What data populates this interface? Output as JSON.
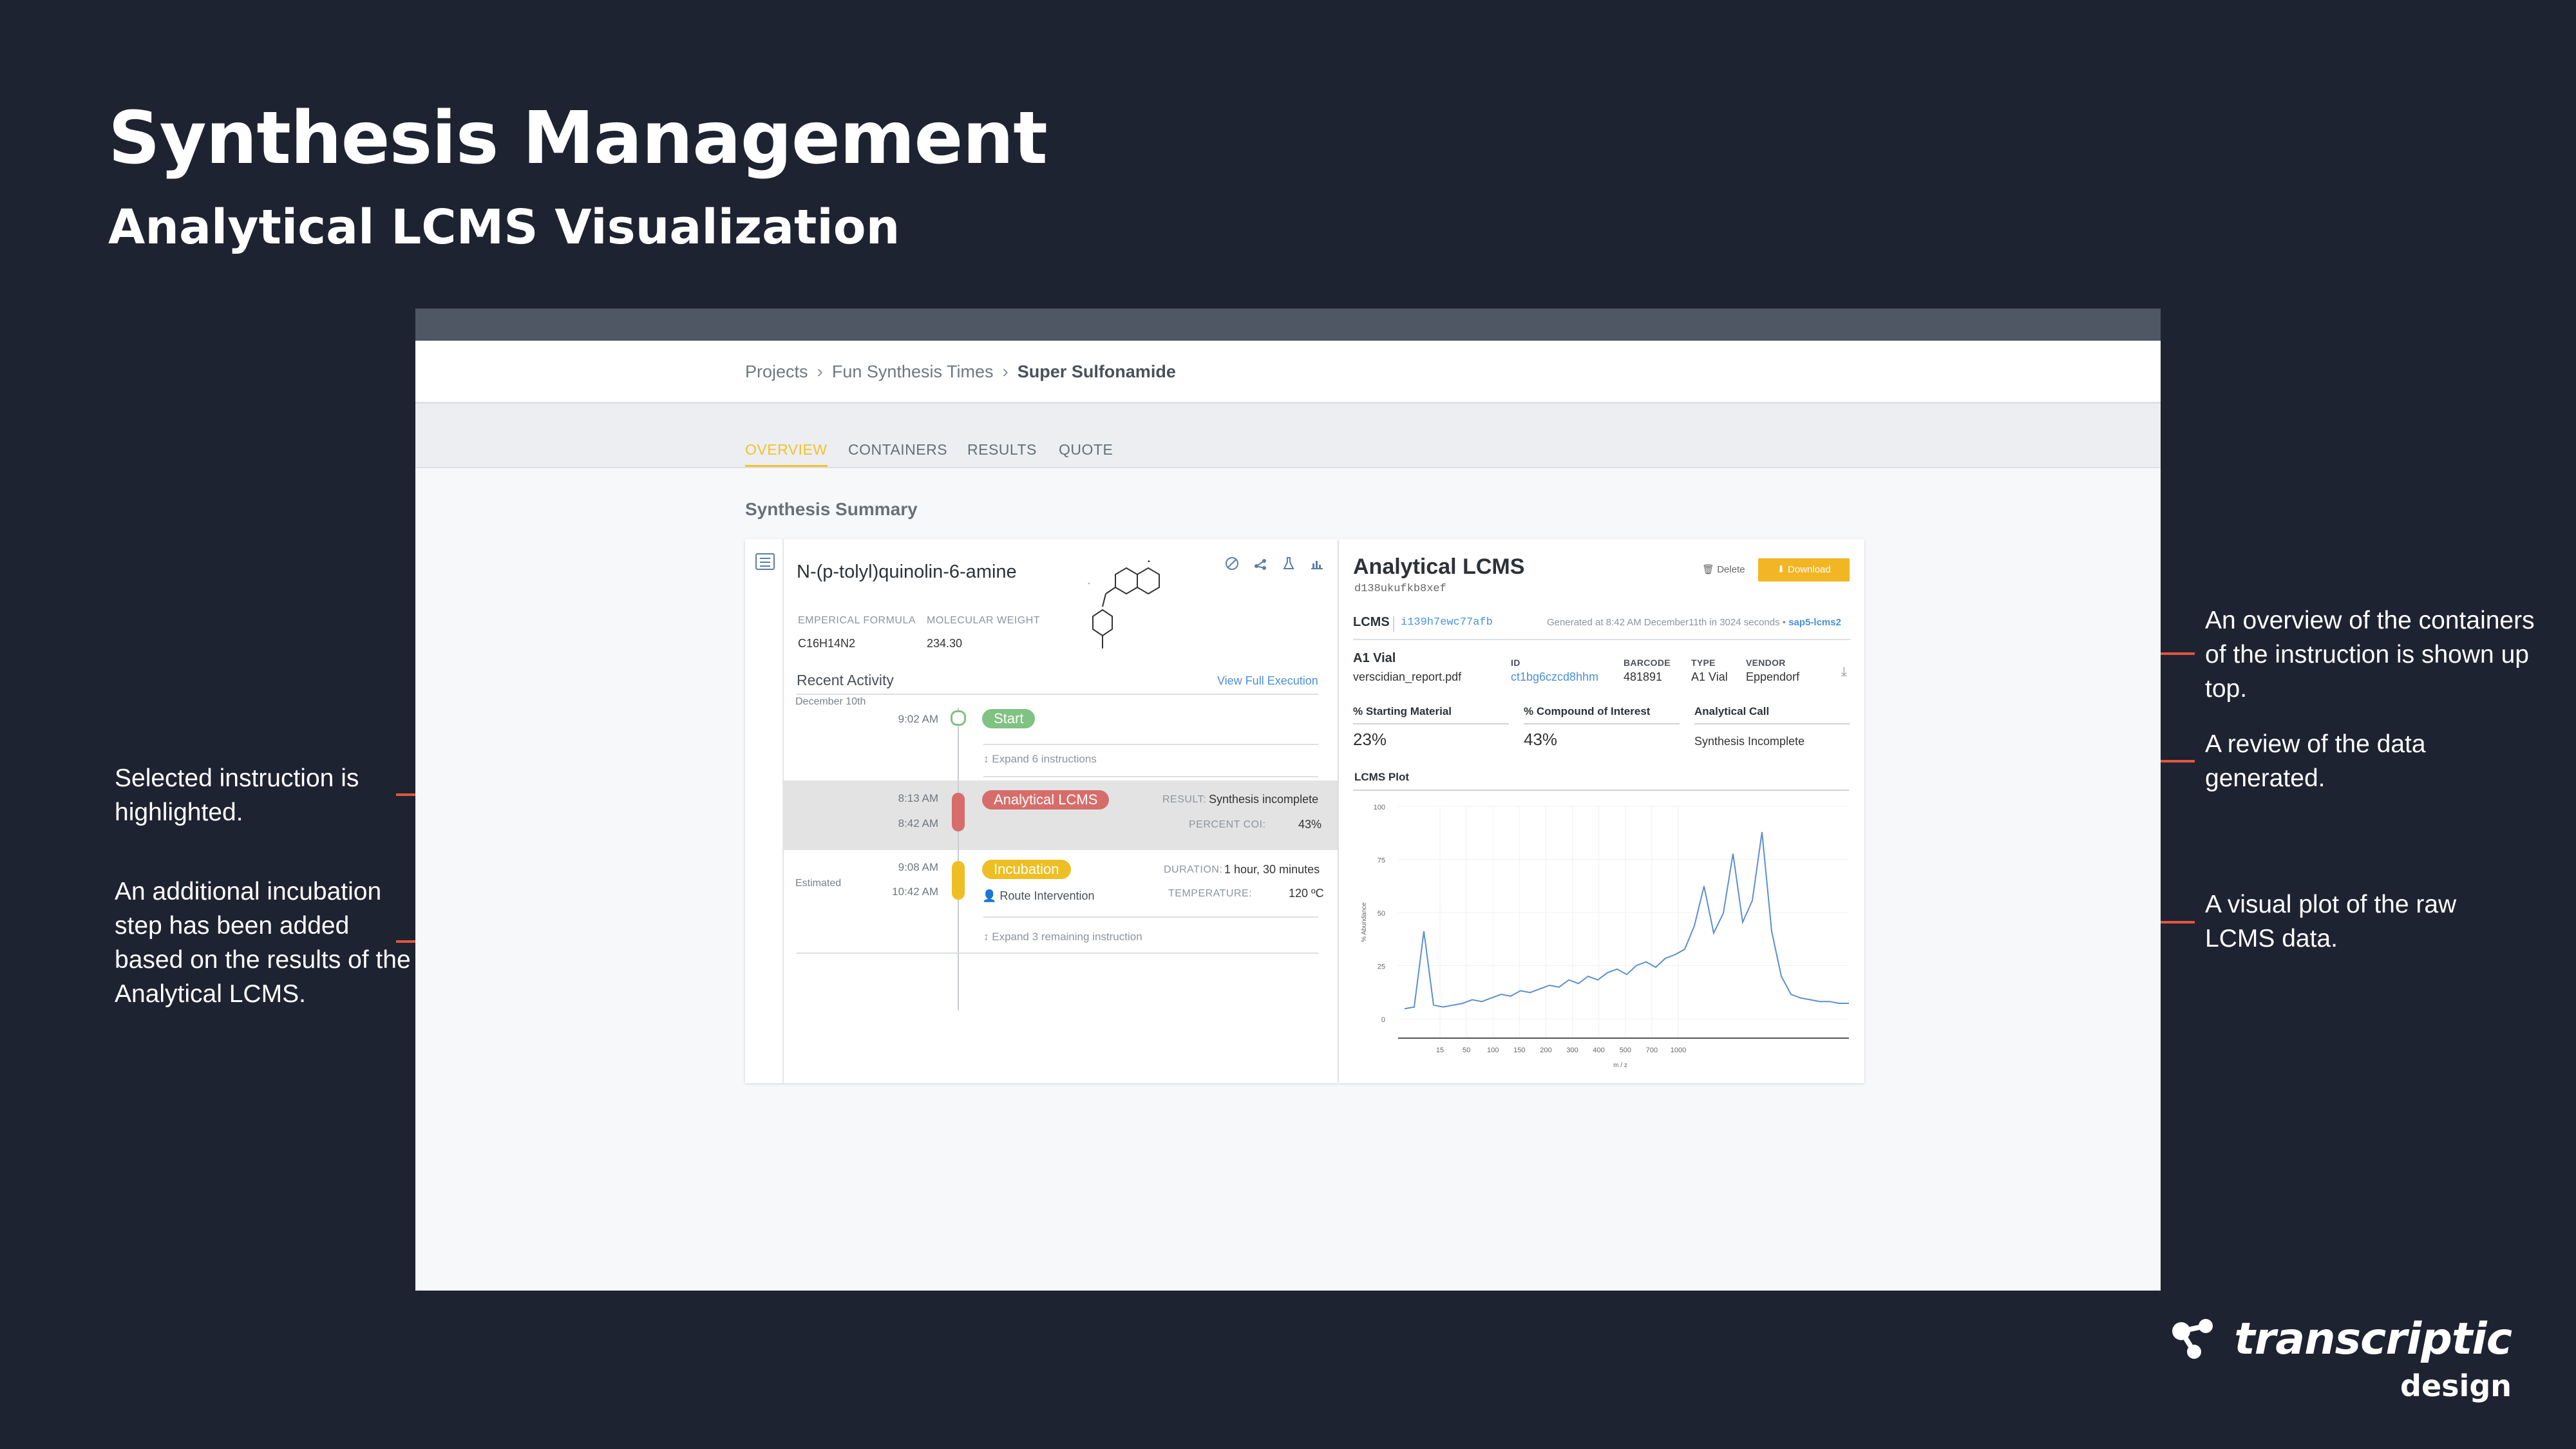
{
  "slide": {
    "title": "Synthesis Management",
    "subtitle": "Analytical LCMS Visualization"
  },
  "notes": {
    "left": [
      "Selected instruction is highlighted.",
      "An additional incubation step has been added based on the results of the Analytical LCMS."
    ],
    "right": [
      "An overview of the containers of the instruction is shown up top.",
      "A review of the data generated.",
      "A visual plot of the raw LCMS data."
    ]
  },
  "brand": {
    "name": "transcriptic",
    "sub": "design"
  },
  "breadcrumb": {
    "items": [
      "Projects",
      "Fun Synthesis Times",
      "Super Sulfonamide"
    ],
    "separator": "›"
  },
  "tabs": [
    "OVERVIEW",
    "CONTAINERS",
    "RESULTS",
    "QUOTE"
  ],
  "section_title": "Synthesis Summary",
  "compound": {
    "name": "N-(p-tolyl)quinolin-6-amine",
    "formula_label": "EMPERICAL FORMULA",
    "formula": "C16H14N2",
    "weight_label": "MOLECULAR WEIGHT",
    "weight": "234.30"
  },
  "activity": {
    "title": "Recent Activity",
    "link": "View Full Execution",
    "date": "December 10th",
    "estimated": "Estimated",
    "start": {
      "time": "9:02 AM",
      "label": "Start"
    },
    "expand1": "Expand 6 instructions",
    "lcms": {
      "time_start": "8:13 AM",
      "time_end": "8:42 AM",
      "label": "Analytical LCMS",
      "result_label": "RESULT:",
      "result": "Synthesis incomplete",
      "percent_label": "PERCENT COI:",
      "percent": "43%"
    },
    "incubation": {
      "time_start": "9:08 AM",
      "time_end": "10:42 AM",
      "label": "Incubation",
      "duration_label": "DURATION:",
      "duration": "1 hour, 30 minutes",
      "route": "Route Intervention",
      "temp_label": "TEMPERATURE:",
      "temp": "120 ºC"
    },
    "expand2": "Expand 3 remaining instruction"
  },
  "analytical": {
    "title": "Analytical LCMS",
    "hash": "d138ukufkb8xef",
    "delete": "Delete",
    "download": "Download",
    "lcms_label": "LCMS",
    "lcms_id": "i139h7ewc77afb",
    "generated": "Generated at 8:42 AM December11th in 3024 seconds •",
    "generated_link": "sap5-lcms2",
    "container": {
      "name": "A1 Vial",
      "file": "verscidian_report.pdf",
      "id_label": "ID",
      "id": "ct1bg6czcd8hhm",
      "barcode_label": "BARCODE",
      "barcode": "481891",
      "type_label": "TYPE",
      "type": "A1 Vial",
      "vendor_label": "VENDOR",
      "vendor": "Eppendorf"
    },
    "metrics": {
      "start_label": "% Starting Material",
      "start_val": "23%",
      "coi_label": "% Compound of Interest",
      "coi_val": "43%",
      "call_label": "Analytical Call",
      "call_val": "Synthesis Incomplete"
    },
    "plot_title": "LCMS Plot"
  },
  "chart_data": {
    "type": "line",
    "title": "LCMS Plot",
    "xlabel": "m / z",
    "ylabel": "% Abundance",
    "x_ticks": [
      "15",
      "50",
      "100",
      "150",
      "200",
      "300",
      "400",
      "500",
      "700",
      "1000"
    ],
    "y_ticks": [
      "0",
      "25",
      "50",
      "75",
      "100"
    ],
    "ylim": [
      0,
      100
    ],
    "series": [
      {
        "values": [
          2,
          3,
          45,
          4,
          3,
          4,
          5,
          7,
          6,
          8,
          10,
          9,
          12,
          11,
          13,
          15,
          14,
          18,
          16,
          20,
          18,
          22,
          24,
          21,
          26,
          28,
          25,
          30,
          32,
          35,
          48,
          70,
          44,
          55,
          88,
          50,
          62,
          100,
          45,
          20,
          10,
          8,
          7,
          6,
          6,
          5,
          5
        ]
      }
    ]
  },
  "colors": {
    "accent": "#e3553f",
    "background": "#1d2331",
    "active_tab": "#f2c32b",
    "start": "#7fc281",
    "lcms": "#d76d6a",
    "incubation": "#edbf24",
    "plot_line": "#5b8fd0"
  },
  "icons": {
    "list": "list-icon",
    "actions": [
      "ban-icon",
      "share-icon",
      "flask-icon",
      "chart-icon"
    ],
    "delete": "trash-icon",
    "download": "download-icon",
    "file_download": "file-download-icon",
    "route": "person-icon",
    "expand": "expand-arrows-icon"
  }
}
